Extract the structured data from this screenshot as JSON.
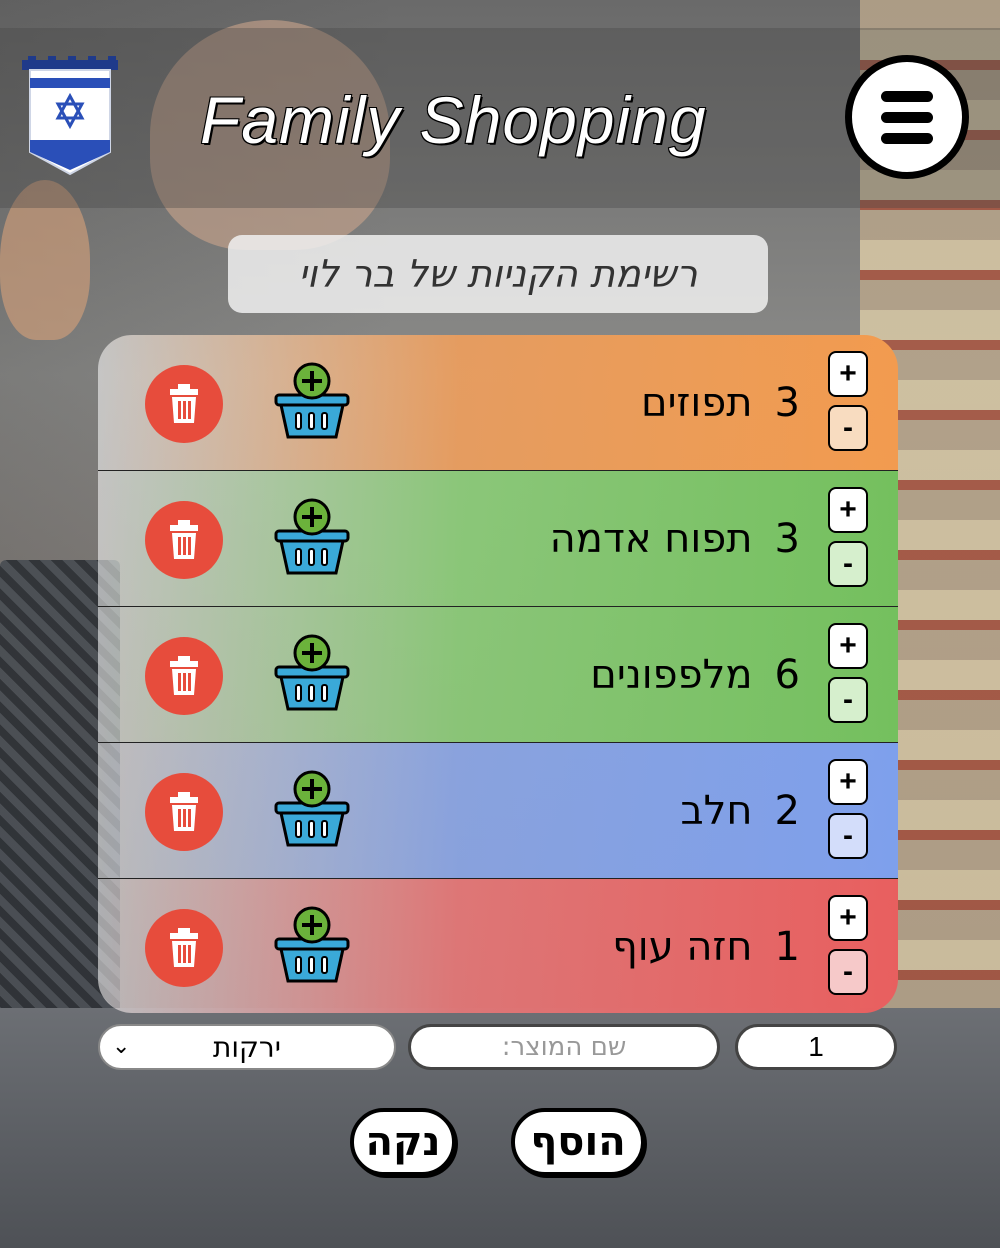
{
  "header": {
    "title": "Family Shopping",
    "flag_icon": "israel-flag-banner-icon",
    "menu_icon": "hamburger-menu-icon"
  },
  "list_title": "רשימת הקניות של בר לוי",
  "items": [
    {
      "qty": "3",
      "name": "תפוזים",
      "color": "#f29b4f"
    },
    {
      "qty": "3",
      "name": "תפוח אדמה",
      "color": "#74c05e"
    },
    {
      "qty": "6",
      "name": "מלפפונים",
      "color": "#74c05e"
    },
    {
      "qty": "2",
      "name": "חלב",
      "color": "#7ea0ec"
    },
    {
      "qty": "1",
      "name": "חזה עוף",
      "color": "#e85f5f"
    }
  ],
  "stepper": {
    "plus": "+",
    "minus": "-"
  },
  "form": {
    "category_value": "ירקות",
    "name_placeholder": "שם המוצר:",
    "qty_value": "1"
  },
  "buttons": {
    "add_label": "הוסף",
    "clear_label": "נקה"
  }
}
